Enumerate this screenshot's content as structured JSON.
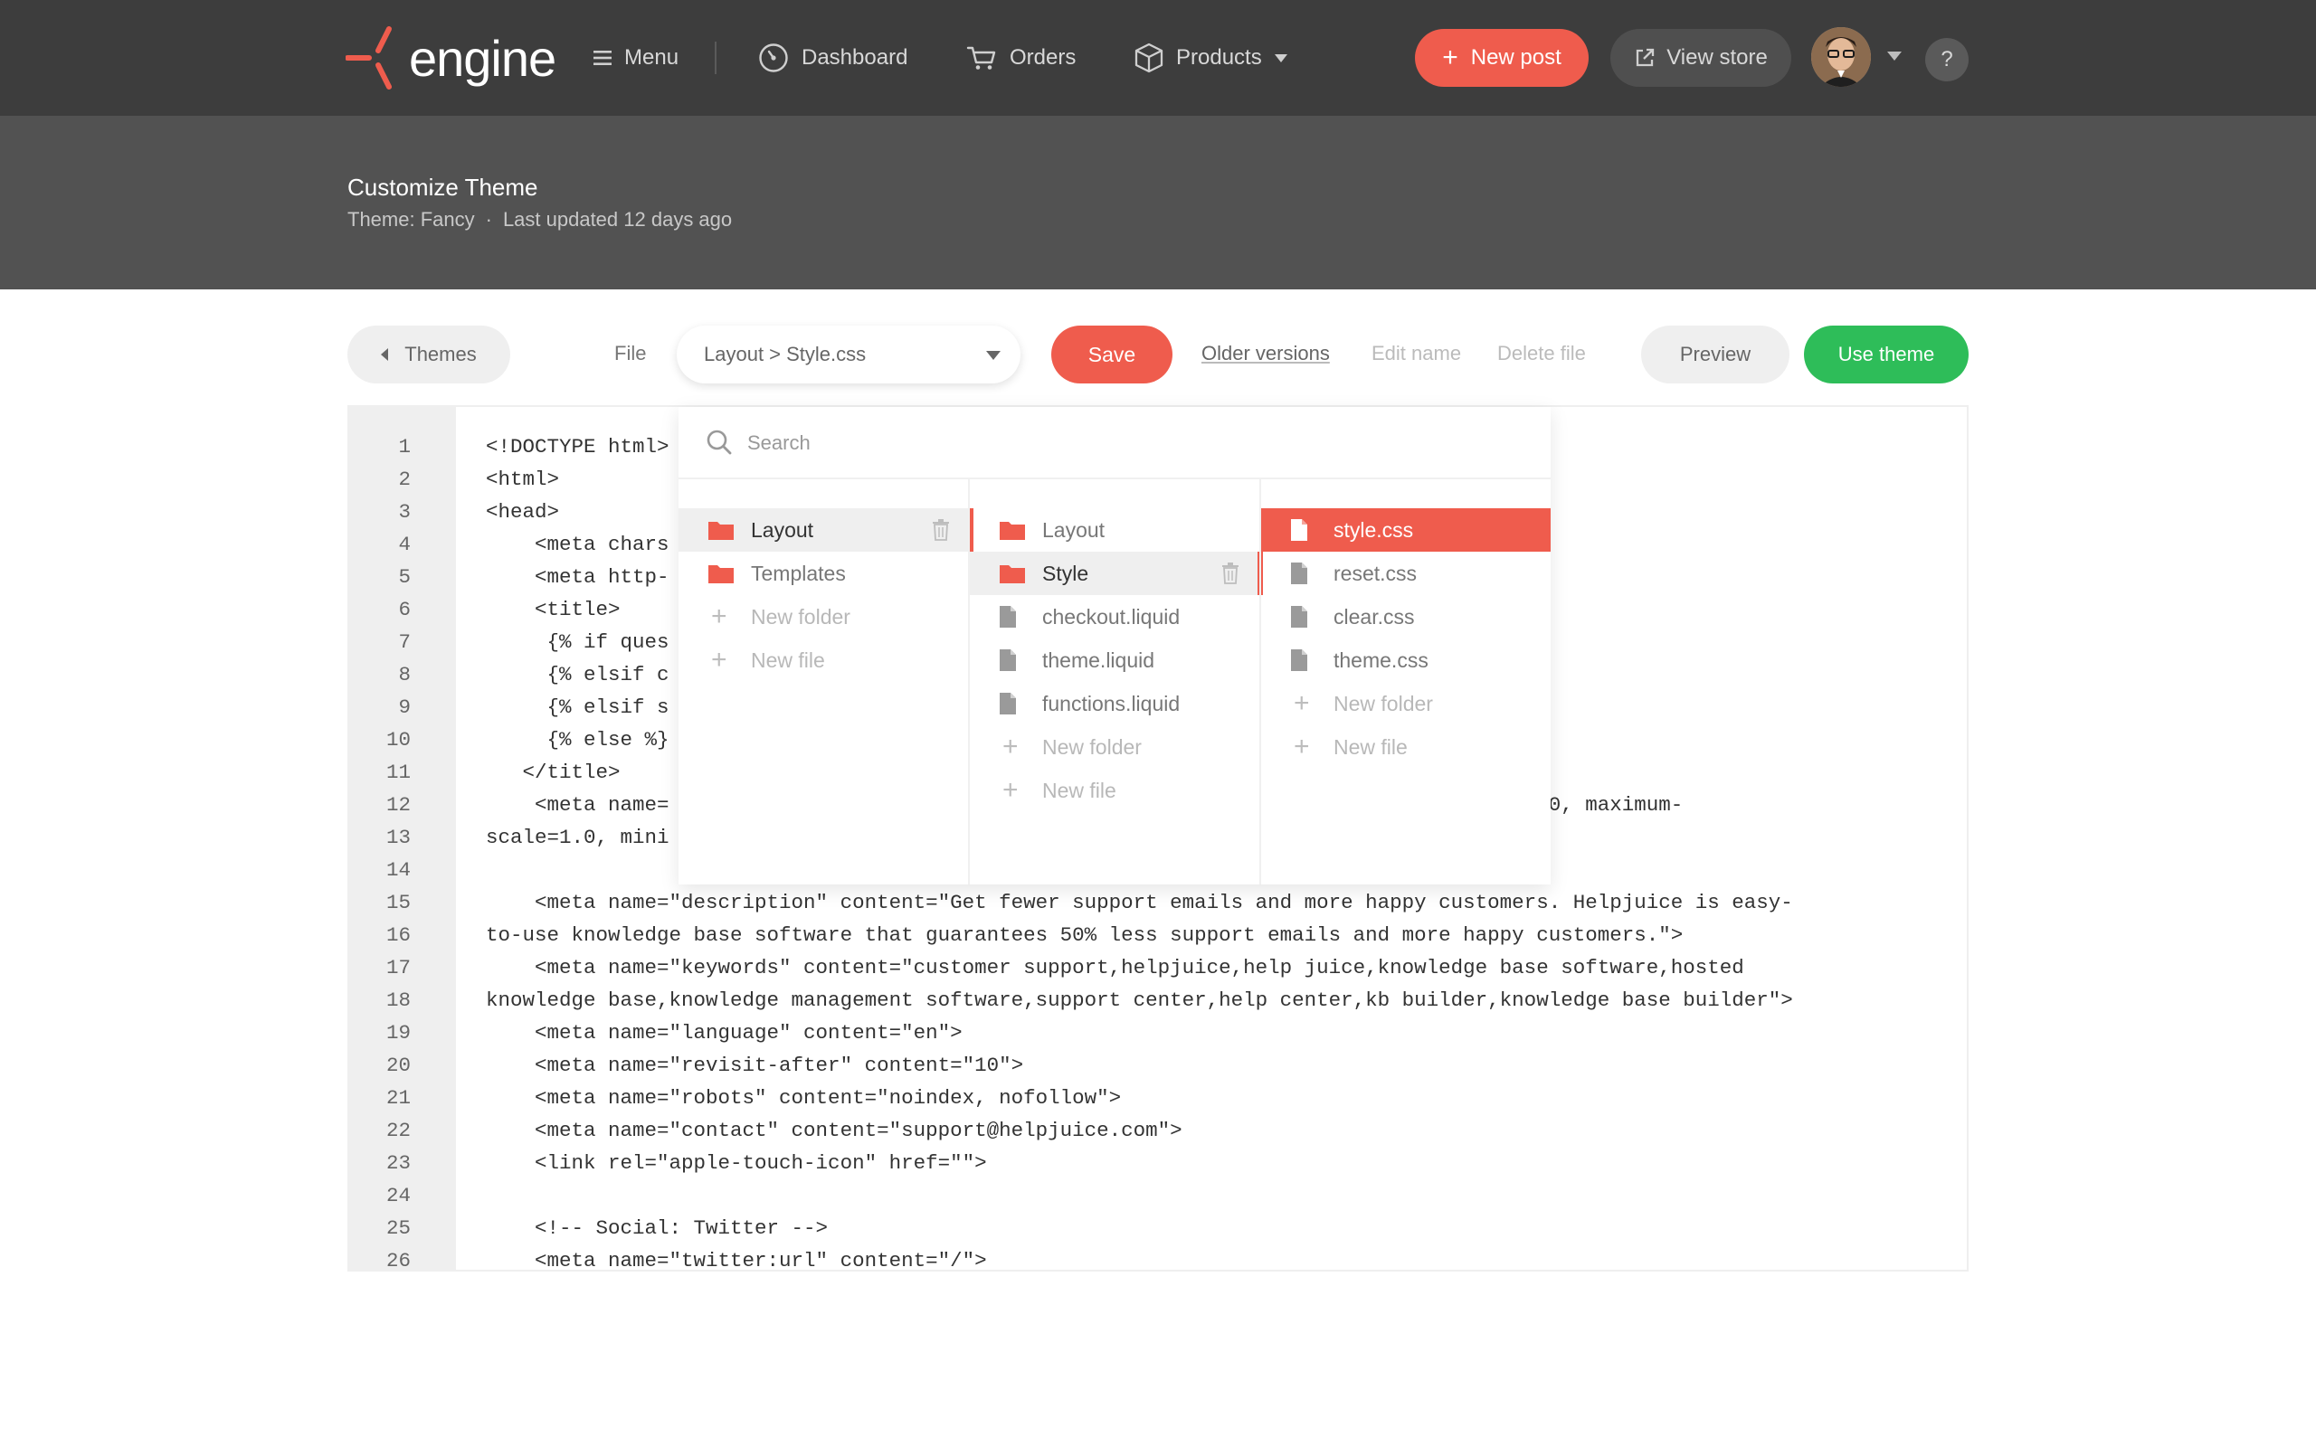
{
  "brand": {
    "name": "engine",
    "accent": "#ef5c4d"
  },
  "nav": {
    "menu_label": "Menu",
    "dashboard_label": "Dashboard",
    "orders_label": "Orders",
    "products_label": "Products",
    "new_post_label": "New post",
    "view_store_label": "View store",
    "help_label": "?"
  },
  "header": {
    "title": "Customize Theme",
    "theme_label": "Theme: Fancy",
    "separator": "·",
    "updated": "Last updated 12 days ago"
  },
  "toolbar": {
    "themes_label": "Themes",
    "file_label": "File",
    "file_value": "Layout > Style.css",
    "save_label": "Save",
    "older_versions_label": "Older versions",
    "edit_name_label": "Edit name",
    "delete_file_label": "Delete file",
    "preview_label": "Preview",
    "use_theme_label": "Use theme",
    "use_theme_color": "#2ebd59"
  },
  "browser": {
    "search_placeholder": "Search",
    "columns": [
      {
        "items": [
          {
            "label": "Layout",
            "icon": "folder-icon",
            "state": "selected"
          },
          {
            "label": "Templates",
            "icon": "folder-icon",
            "state": "normal"
          },
          {
            "label": "New folder",
            "icon": "plus-icon",
            "state": "muted"
          },
          {
            "label": "New file",
            "icon": "plus-icon",
            "state": "muted"
          }
        ]
      },
      {
        "items": [
          {
            "label": "Layout",
            "icon": "folder-icon",
            "state": "normal"
          },
          {
            "label": "Style",
            "icon": "folder-icon",
            "state": "selected"
          },
          {
            "label": "checkout.liquid",
            "icon": "file-icon",
            "state": "normal"
          },
          {
            "label": "theme.liquid",
            "icon": "file-icon",
            "state": "normal"
          },
          {
            "label": "functions.liquid",
            "icon": "file-icon",
            "state": "normal"
          },
          {
            "label": "New folder",
            "icon": "plus-icon",
            "state": "muted"
          },
          {
            "label": "New file",
            "icon": "plus-icon",
            "state": "muted"
          }
        ]
      },
      {
        "items": [
          {
            "label": "style.css",
            "icon": "file-icon",
            "state": "active"
          },
          {
            "label": "reset.css",
            "icon": "file-icon",
            "state": "normal"
          },
          {
            "label": "clear.css",
            "icon": "file-icon",
            "state": "normal"
          },
          {
            "label": "theme.css",
            "icon": "file-icon",
            "state": "normal"
          },
          {
            "label": "New folder",
            "icon": "plus-icon",
            "state": "muted"
          },
          {
            "label": "New file",
            "icon": "plus-icon",
            "state": "muted"
          }
        ]
      }
    ]
  },
  "editor": {
    "lines": [
      {
        "n": "1",
        "text": "<!DOCTYPE html>"
      },
      {
        "n": "2",
        "text": "<html>"
      },
      {
        "n": "3",
        "text": "<head>"
      },
      {
        "n": "4",
        "text": "    <meta chars"
      },
      {
        "n": "5",
        "text": "    <meta http-"
      },
      {
        "n": "6",
        "text": "    <title>"
      },
      {
        "n": "7",
        "text": "     {% if ques"
      },
      {
        "n": "8",
        "text": "     {% elsif c"
      },
      {
        "n": "9",
        "text": "     {% elsif s                                                                       t"
      },
      {
        "n": "10",
        "text": "     {% else %}"
      },
      {
        "n": "11",
        "text": "   </title>"
      },
      {
        "n": "12",
        "text": "    <meta name=                                                                 cale=1.0, maximum-"
      },
      {
        "n": "13",
        "text": "scale=1.0, mini"
      },
      {
        "n": "14",
        "text": ""
      },
      {
        "n": "15",
        "text": "    <meta name=\"description\" content=\"Get fewer support emails and more happy customers. Helpjuice is easy-"
      },
      {
        "n": "16",
        "text": "to-use knowledge base software that guarantees 50% less support emails and more happy customers.\">"
      },
      {
        "n": "17",
        "text": "    <meta name=\"keywords\" content=\"customer support,helpjuice,help juice,knowledge base software,hosted"
      },
      {
        "n": "18",
        "text": "knowledge base,knowledge management software,support center,help center,kb builder,knowledge base builder\">"
      },
      {
        "n": "19",
        "text": "    <meta name=\"language\" content=\"en\">"
      },
      {
        "n": "20",
        "text": "    <meta name=\"revisit-after\" content=\"10\">"
      },
      {
        "n": "21",
        "text": "    <meta name=\"robots\" content=\"noindex, nofollow\">"
      },
      {
        "n": "22",
        "text": "    <meta name=\"contact\" content=\"support@helpjuice.com\">"
      },
      {
        "n": "23",
        "text": "    <link rel=\"apple-touch-icon\" href=\"\">"
      },
      {
        "n": "24",
        "text": ""
      },
      {
        "n": "25",
        "text": "    <!-- Social: Twitter -->"
      },
      {
        "n": "26",
        "text": "    <meta name=\"twitter:url\" content=\"/\">"
      }
    ]
  }
}
